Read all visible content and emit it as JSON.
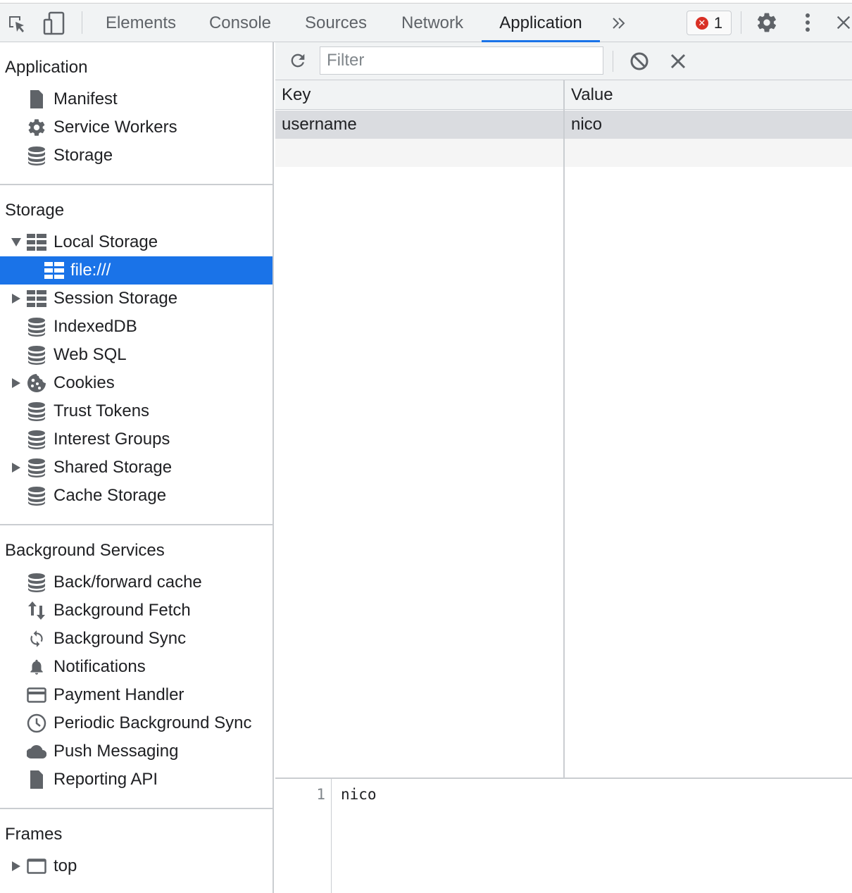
{
  "topbar": {
    "tabs": [
      {
        "label": "Elements"
      },
      {
        "label": "Console"
      },
      {
        "label": "Sources"
      },
      {
        "label": "Network"
      },
      {
        "label": "Application",
        "active": true
      }
    ],
    "error_count": "1",
    "icons": [
      "inspect-element-icon",
      "device-toolbar-icon",
      "more-tabs-icon",
      "error-icon",
      "gear-icon",
      "more-vert-icon",
      "close-icon"
    ]
  },
  "sidebar": {
    "application": {
      "title": "Application",
      "items": [
        {
          "label": "Manifest",
          "icon": "document-icon"
        },
        {
          "label": "Service Workers",
          "icon": "gear-icon"
        },
        {
          "label": "Storage",
          "icon": "database-icon"
        }
      ]
    },
    "storage": {
      "title": "Storage",
      "items": [
        {
          "label": "Local Storage",
          "icon": "table-icon",
          "expanded": true
        },
        {
          "label": "file:///",
          "icon": "table-icon",
          "selected": true
        },
        {
          "label": "Session Storage",
          "icon": "table-icon",
          "expanded": false
        },
        {
          "label": "IndexedDB",
          "icon": "database-icon"
        },
        {
          "label": "Web SQL",
          "icon": "database-icon"
        },
        {
          "label": "Cookies",
          "icon": "cookie-icon",
          "expanded": false
        },
        {
          "label": "Trust Tokens",
          "icon": "database-icon"
        },
        {
          "label": "Interest Groups",
          "icon": "database-icon"
        },
        {
          "label": "Shared Storage",
          "icon": "database-icon",
          "expanded": false
        },
        {
          "label": "Cache Storage",
          "icon": "database-icon"
        }
      ]
    },
    "background_services": {
      "title": "Background Services",
      "items": [
        {
          "label": "Back/forward cache",
          "icon": "database-icon"
        },
        {
          "label": "Background Fetch",
          "icon": "up-down-arrows-icon"
        },
        {
          "label": "Background Sync",
          "icon": "sync-icon"
        },
        {
          "label": "Notifications",
          "icon": "bell-icon"
        },
        {
          "label": "Payment Handler",
          "icon": "credit-card-icon"
        },
        {
          "label": "Periodic Background Sync",
          "icon": "clock-icon"
        },
        {
          "label": "Push Messaging",
          "icon": "cloud-icon"
        },
        {
          "label": "Reporting API",
          "icon": "document-icon"
        }
      ]
    },
    "frames": {
      "title": "Frames",
      "items": [
        {
          "label": "top",
          "icon": "frame-icon",
          "expanded": false
        }
      ]
    }
  },
  "main": {
    "filter_placeholder": "Filter",
    "grid": {
      "columns": [
        "Key",
        "Value"
      ],
      "rows": [
        {
          "key": "username",
          "value": "nico"
        }
      ]
    },
    "preview": {
      "line_number": "1",
      "content": "nico"
    }
  },
  "colors": {
    "accent": "#1a73e8",
    "error": "#d93025",
    "icon_gray": "#5f6368"
  }
}
